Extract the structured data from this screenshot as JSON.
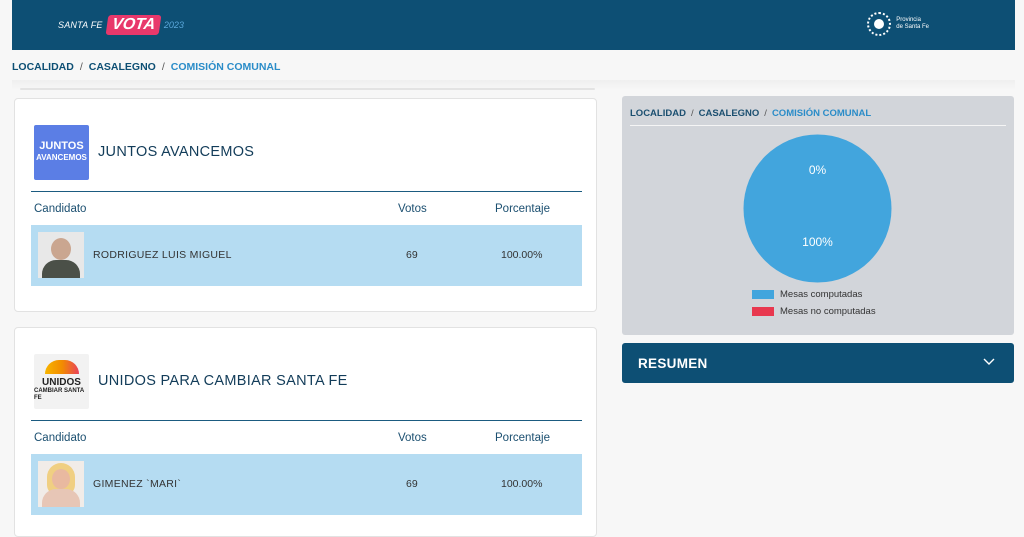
{
  "header": {
    "logo_prefix": "SANTA FE",
    "logo_main": "VOTA",
    "logo_year": "2023",
    "province_line1": "Provincia",
    "province_line2": "de Santa Fe"
  },
  "breadcrumb": {
    "item1": "LOCALIDAD",
    "item2": "CASALEGNO",
    "item3": "COMISIÓN COMUNAL"
  },
  "table_headers": {
    "candidate": "Candidato",
    "votes": "Votos",
    "percent": "Porcentaje"
  },
  "parties": [
    {
      "name": "JUNTOS AVANCEMOS",
      "logo_text1": "JUNTOS",
      "logo_text2": "AVANCEMOS",
      "candidate": {
        "name": "RODRIGUEZ LUIS MIGUEL",
        "votes": "69",
        "percent": "100.00%"
      }
    },
    {
      "name": "UNIDOS PARA CAMBIAR SANTA FE",
      "logo_text1": "UNIDOS",
      "logo_text2": "CAMBIAR SANTA FE",
      "candidate": {
        "name": "GIMENEZ `MARI`",
        "votes": "69",
        "percent": "100.00%"
      }
    }
  ],
  "chart_panel": {
    "breadcrumb": {
      "item1": "LOCALIDAD",
      "item2": "CASALEGNO",
      "item3": "COMISIÓN COMUNAL"
    },
    "legend": {
      "computed": "Mesas computadas",
      "not_computed": "Mesas no computadas"
    }
  },
  "chart_data": {
    "type": "pie",
    "categories": [
      "Mesas computadas",
      "Mesas no computadas"
    ],
    "values": [
      100,
      0
    ],
    "labels": [
      "100%",
      "0%"
    ],
    "colors": [
      "#42a5dd",
      "#e8384f"
    ],
    "legend": "bottom"
  },
  "summary": {
    "title": "RESUMEN"
  },
  "colors": {
    "brand": "#0d4f74",
    "accent": "#e8386b",
    "row": "#b5dcf2",
    "link": "#2a8cc8"
  }
}
